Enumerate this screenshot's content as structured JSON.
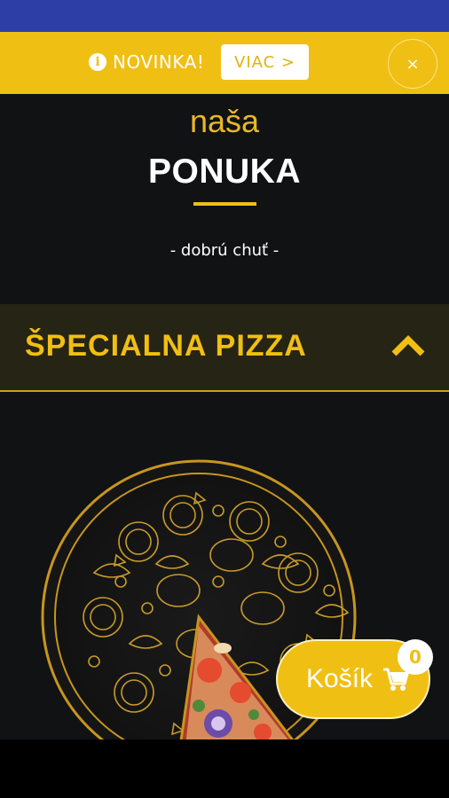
{
  "promo": {
    "icon": "info-icon",
    "text": "NOVINKA!",
    "button_label": "VIAC >",
    "close_label": "×"
  },
  "menu": {
    "subtitle": "naša",
    "title": "PONUKA",
    "tagline": "- dobrú chuť -"
  },
  "category": {
    "title": "ŠPECIALNA PIZZA",
    "expanded": true,
    "chevron_icon": "chevron-up-icon"
  },
  "cart": {
    "label": "Košík",
    "count": "0",
    "icon": "cart-icon"
  },
  "colors": {
    "accent": "#f0bf13",
    "background": "#111214",
    "status_bar": "#2d3ea6"
  }
}
